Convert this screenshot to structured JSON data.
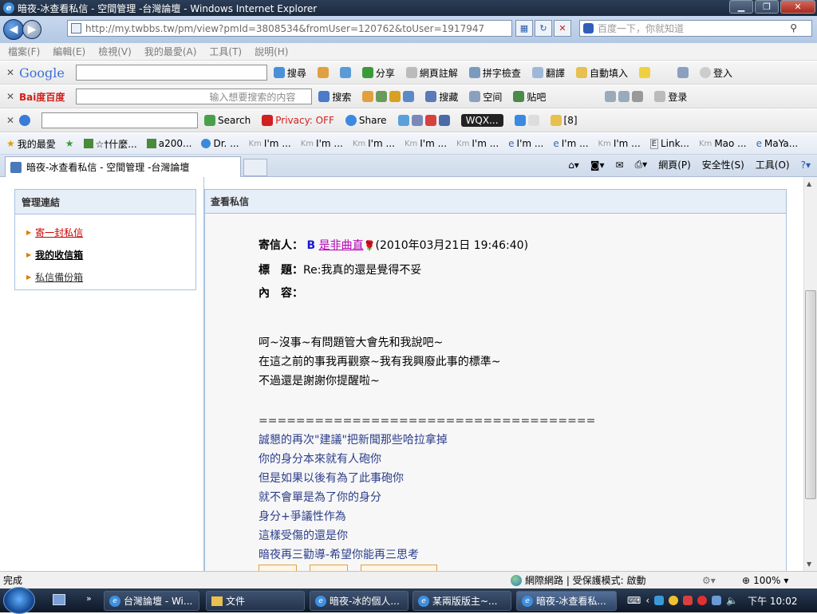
{
  "window": {
    "title": "暗夜-冰查看私信 - 空間管理 -台灣論壇 - Windows Internet Explorer",
    "min": "▁",
    "max": "❐",
    "close": "✕"
  },
  "address": {
    "url": "http://my.twbbs.tw/pm/view?pmId=3808534&fromUser=120762&toUser=1917947",
    "search_placeholder": "百度一下，你就知道"
  },
  "menu": [
    "檔案(F)",
    "編輯(E)",
    "檢視(V)",
    "我的最愛(A)",
    "工具(T)",
    "說明(H)"
  ],
  "google_bar": {
    "logo": "Google",
    "items": [
      "搜尋",
      "分享",
      "網頁註解",
      "拼字檢查",
      "翻譯",
      "自動填入",
      "登入"
    ]
  },
  "baidu_bar": {
    "logo": "Bai度百度",
    "placeholder": "输入想要搜索的内容",
    "items": [
      "搜索",
      "搜藏",
      "空间",
      "贴吧",
      "登录"
    ]
  },
  "third_bar": {
    "items": [
      "Search",
      "Privacy: OFF",
      "Share",
      "WQX...",
      "[8]"
    ]
  },
  "favorites": {
    "label": "我的最愛",
    "items": [
      "☆†什麼...",
      "a200...",
      "Dr. ...",
      "I'm ...",
      "I'm ...",
      "I'm ...",
      "I'm ...",
      "I'm ...",
      "I'm ...",
      "I'm ...",
      "I'm ...",
      "Link...",
      "Mao ...",
      "MaYa..."
    ]
  },
  "tab": {
    "title": "暗夜-冰查看私信 - 空間管理 -台灣論壇"
  },
  "commands": [
    "網頁(P)",
    "安全性(S)",
    "工具(O)"
  ],
  "sidebar": {
    "title": "管理連結",
    "links": [
      "寄一封私信",
      "我的收信箱",
      "私信備份箱"
    ]
  },
  "main": {
    "title": "查看私信",
    "sender_label": "寄信人：",
    "sender_b": "B",
    "sender_name": "是非曲直",
    "sender_time": "(2010年03月21日 19:46:40)",
    "subject_label": "標　題：",
    "subject": "Re:我真的還是覺得不妥",
    "content_label": "內　容：",
    "body": [
      "呵~沒事~有問題管大會先和我說吧~",
      "在這之前的事我再觀察~我有我興廢此事的標準~",
      "不過還是謝謝你提醒啦~"
    ],
    "quote": [
      "====================================",
      "誠懇的再次\"建議\"把新聞那些哈拉拿掉",
      "你的身分本來就有人砲你",
      "但是如果以後有為了此事砲你",
      "就不會單是為了你的身分",
      "身分+爭議性作為",
      "這樣受傷的還是你",
      "暗夜再三勸導-希望你能再三思考"
    ]
  },
  "status": {
    "text": "完成",
    "zone": "網際網路 | 受保護模式: 啟動",
    "zoom": "100%"
  },
  "taskbar": {
    "items": [
      "台灣論壇 - Wi...",
      "文件",
      "暗夜-冰的個人...",
      "某兩版版主~...",
      "暗夜-冰查看私..."
    ],
    "clock": "下午 10:02"
  }
}
